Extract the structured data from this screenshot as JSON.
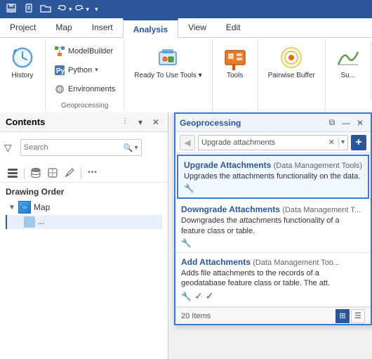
{
  "ribbon": {
    "qat_label": "Quick Access Toolbar",
    "tabs": [
      "Project",
      "Map",
      "Insert",
      "Analysis",
      "View",
      "Edit"
    ],
    "active_tab": "Analysis",
    "groups": {
      "history": {
        "label": "History",
        "button_label": "History"
      },
      "right_group": {
        "modelbuilder_label": "ModelBuilder",
        "python_label": "Python",
        "environments_label": "Environments"
      },
      "ready_to_use": {
        "label": "Ready To Use Tools",
        "arrow": "▾"
      },
      "tools": {
        "label": "Tools"
      },
      "pairwise_buffer": {
        "label": "Pairwise Buffer"
      },
      "surface": {
        "label": "Su..."
      },
      "section_label": "Geoprocessing"
    }
  },
  "left_panel": {
    "title": "Contents",
    "search_placeholder": "Search",
    "drawing_order_label": "Drawing Order",
    "map_item_label": "Map",
    "sub_item_label": "...",
    "toolbar_icons": [
      "filter",
      "list",
      "cylinder",
      "polygon",
      "pencil",
      "more"
    ]
  },
  "right_panel": {
    "title": "Geoprocessing",
    "search_value": "Upgrade attachments",
    "results": [
      {
        "title": "Upgrade Attachments",
        "source": " (Data Management Tools)",
        "description": "Upgrades the attachments functionality on the data.",
        "highlighted": true
      },
      {
        "title": "Downgrade Attachments",
        "source": " (Data Management T...",
        "description": "Downgrades the attachments functionality of a feature class or table.",
        "highlighted": false
      },
      {
        "title": "Add Attachments",
        "source": " (Data Management Too...",
        "description": "Adds file attachments to the records of a geodatabase feature class or table. The att.",
        "highlighted": false,
        "has_check_green": true,
        "has_check_blue": true
      }
    ],
    "footer_count": "20 Items",
    "nav_back_disabled": true,
    "nav_forward_disabled": true
  }
}
